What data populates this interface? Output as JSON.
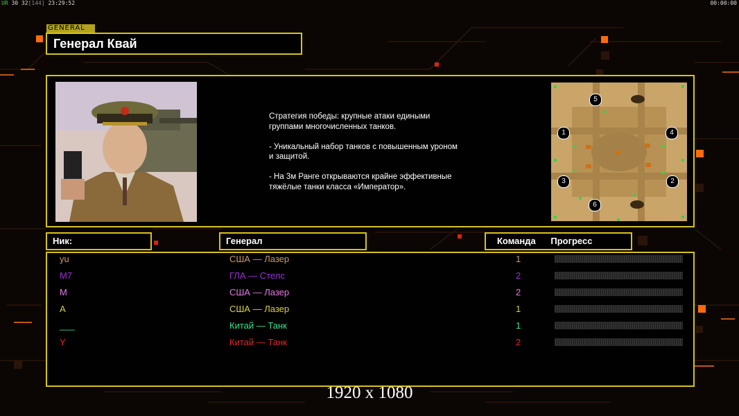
{
  "status_bar": {
    "left_tag": "UR",
    "left_fps": "30 32",
    "left_bracket": "[144]",
    "left_time": "23:29:52",
    "right_time": "00:00:00"
  },
  "general": {
    "tag": "GENERAL",
    "name": "Генерал Квай",
    "description": "Стратегия победы: крупные атаки едиными\n группами многочисленных танков.\n\n- Уникальный набор танков с повышенным уроном\n  и защитой.\n\n- На 3м Ранге открываются крайне эффективные\n  тяжёлые танки класса «Император»."
  },
  "map": {
    "start_positions": [
      "1",
      "2",
      "3",
      "4",
      "5",
      "6"
    ]
  },
  "table": {
    "headers": {
      "nick": "Ник:",
      "general": "Генерал",
      "team": "Команда",
      "progress": "Прогресс"
    },
    "rows": [
      {
        "nick": "yu",
        "general": "США — Лазер",
        "team": "1",
        "color": "#c79a6b"
      },
      {
        "nick": "M7",
        "general": "ГЛА — Стелс",
        "team": "2",
        "color": "#9b2fd6"
      },
      {
        "nick": "M",
        "general": "США — Лазер",
        "team": "2",
        "color": "#e27ae6"
      },
      {
        "nick": "A",
        "general": "США — Лазер",
        "team": "1",
        "color": "#d9d04a"
      },
      {
        "nick": "___",
        "general": "Китай — Танк",
        "team": "1",
        "color": "#38e08a"
      },
      {
        "nick": "Y",
        "general": "Китай — Танк",
        "team": "2",
        "color": "#e3262a"
      }
    ]
  },
  "resolution": "1920 x 1080",
  "colors": {
    "frame": "#d6c31c",
    "accent": "#ff6a10",
    "background": "#0b0604"
  }
}
